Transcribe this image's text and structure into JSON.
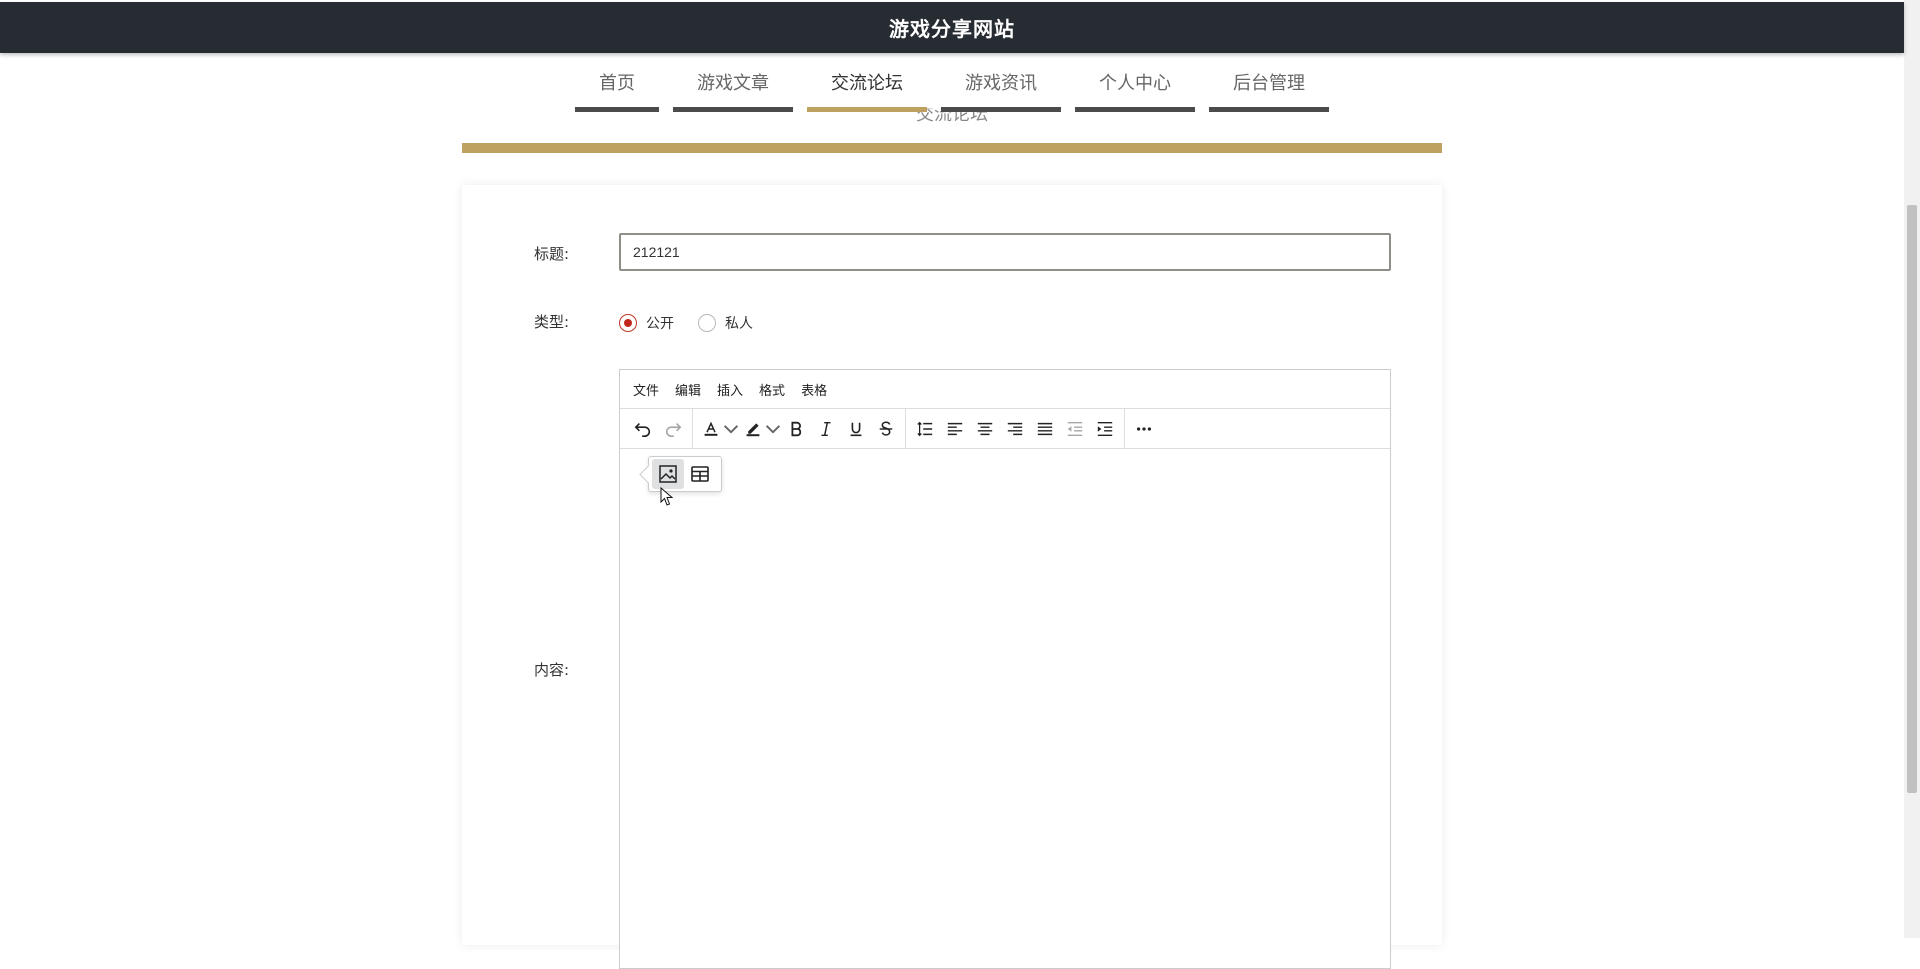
{
  "header": {
    "site_title": "游戏分享网站"
  },
  "nav": {
    "items": [
      {
        "label": "首页",
        "active": false
      },
      {
        "label": "游戏文章",
        "active": false
      },
      {
        "label": "交流论坛",
        "active": true
      },
      {
        "label": "游戏资讯",
        "active": false
      },
      {
        "label": "个人中心",
        "active": false
      },
      {
        "label": "后台管理",
        "active": false
      }
    ]
  },
  "section": {
    "title": "交流论坛"
  },
  "form": {
    "title_label": "标题:",
    "title_value": "212121",
    "type_label": "类型:",
    "type_options": [
      {
        "label": "公开",
        "checked": true
      },
      {
        "label": "私人",
        "checked": false
      }
    ],
    "content_label": "内容:"
  },
  "editor": {
    "menu": [
      "文件",
      "编辑",
      "插入",
      "格式",
      "表格"
    ],
    "toolbar_icons": [
      "undo-icon",
      "redo-icon",
      "text-color-icon",
      "highlight-icon",
      "bold-icon",
      "italic-icon",
      "underline-icon",
      "strikethrough-icon",
      "line-height-icon",
      "align-left-icon",
      "align-center-icon",
      "align-right-icon",
      "align-justify-icon",
      "outdent-icon",
      "indent-icon",
      "more-icon"
    ],
    "quick_insert_icons": [
      "image-icon",
      "table-icon"
    ]
  },
  "colors": {
    "topbar": "#272c33",
    "accent_gold": "#bea15e",
    "nav_underline": "#4b4b4b",
    "radio_checked": "#c0281e"
  }
}
